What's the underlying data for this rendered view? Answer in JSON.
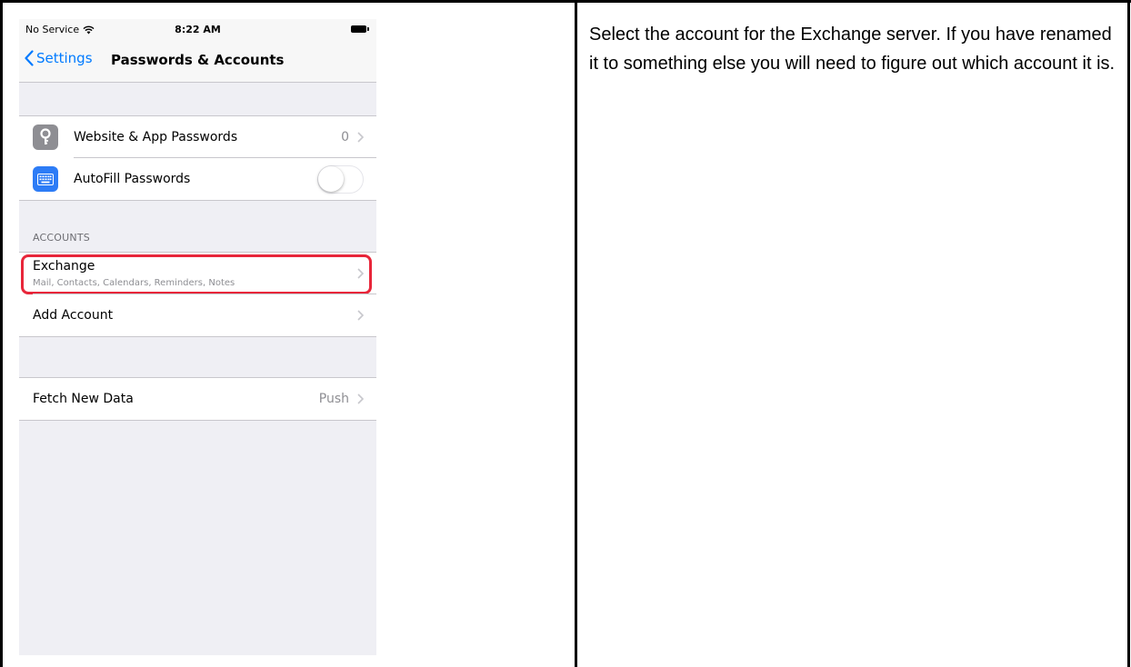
{
  "status_bar": {
    "carrier": "No Service",
    "time": "8:22 AM"
  },
  "nav": {
    "back_label": "Settings",
    "title": "Passwords & Accounts"
  },
  "passwords_group": {
    "website_passwords": {
      "label": "Website & App Passwords",
      "value": "0"
    },
    "autofill": {
      "label": "AutoFill Passwords",
      "enabled": false
    }
  },
  "accounts_section": {
    "header": "ACCOUNTS",
    "exchange": {
      "title": "Exchange",
      "subtitle": "Mail, Contacts, Calendars, Reminders, Notes"
    },
    "add_account": {
      "label": "Add Account"
    }
  },
  "fetch_group": {
    "fetch_new_data": {
      "label": "Fetch New Data",
      "value": "Push"
    }
  },
  "instruction_text": "Select the account for the Exchange server. If you have renamed it to something else you will need to figure out which account it is.",
  "colors": {
    "ios_blue": "#007aff",
    "highlight_red": "#e8263a",
    "key_icon_gray": "#8e8e93",
    "keyboard_icon_blue": "#2d7cf6",
    "grouped_background": "#efeff4"
  },
  "icons": {
    "back": "chevron-left-icon",
    "website_passwords": "key-icon",
    "autofill": "keyboard-icon",
    "disclosure": "chevron-right-icon",
    "wifi": "wifi-icon",
    "battery": "battery-icon"
  }
}
